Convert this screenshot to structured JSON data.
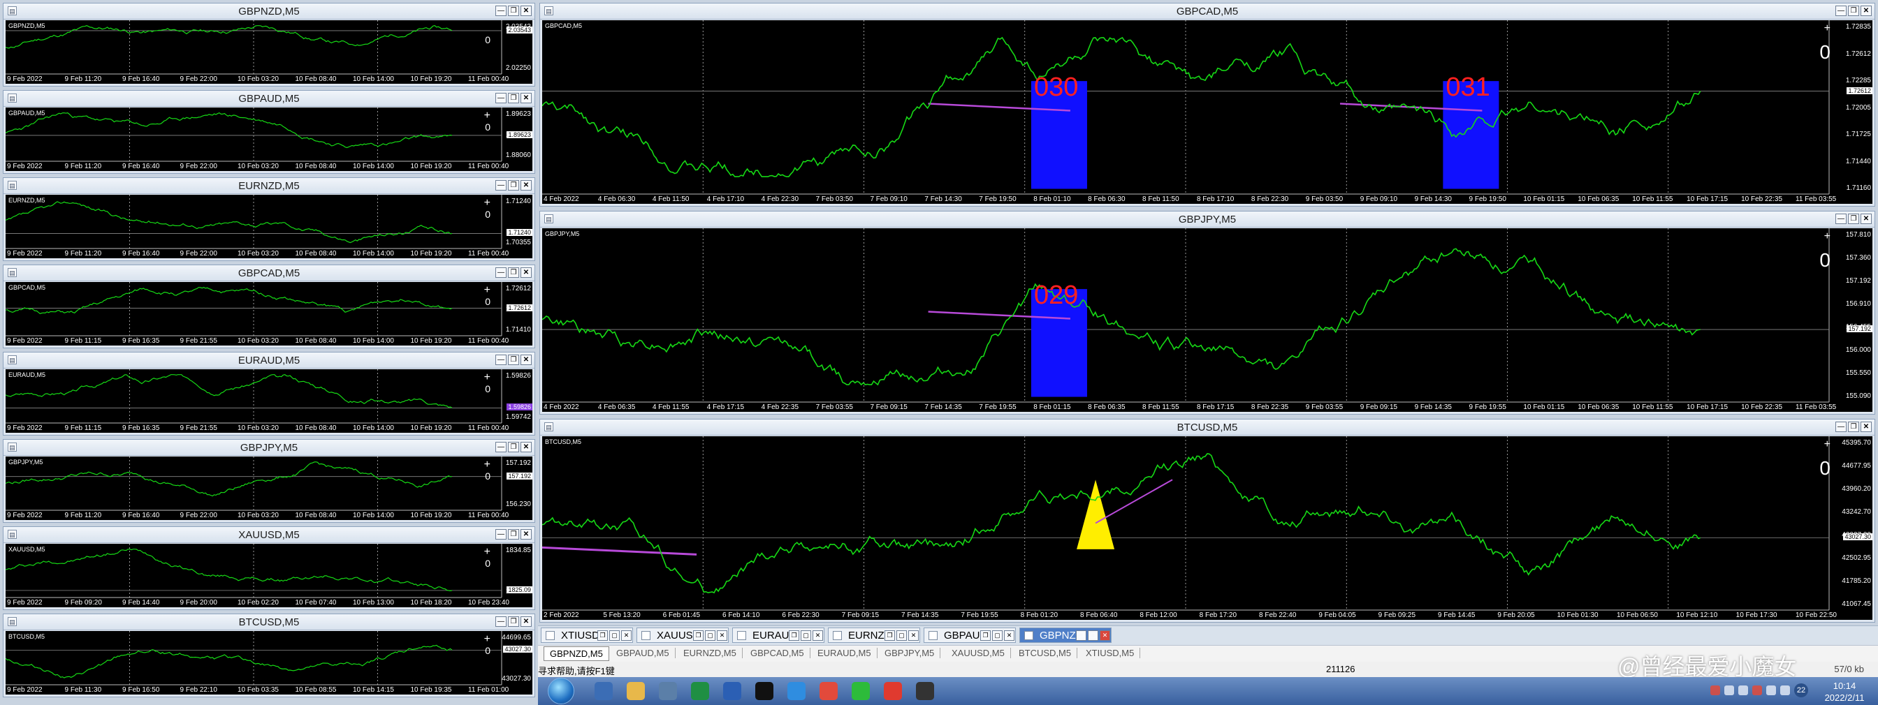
{
  "colors": {
    "line": "#16d915",
    "signal_box": "#1010ff",
    "signal_text": "#ff2020",
    "triangle": "#ffee00",
    "trend": "#b84ad9",
    "chart_bg": "#000000"
  },
  "small_windows": [
    {
      "title": "GBPNZD,M5",
      "symbol": "GBPNZD,M5",
      "seed": 11,
      "x_labels": [
        "9 Feb 2022",
        "9 Feb 11:20",
        "9 Feb 16:40",
        "9 Feb 22:00",
        "10 Feb 03:20",
        "10 Feb 08:40",
        "10 Feb 14:00",
        "10 Feb 19:20",
        "11 Feb 00:40"
      ],
      "price_labels": [
        "2.03543",
        "2.02250"
      ],
      "current_price": "2.03543",
      "plus": "",
      "zero": "0"
    },
    {
      "title": "GBPAUD,M5",
      "symbol": "GBPAUD,M5",
      "seed": 23,
      "x_labels": [
        "9 Feb 2022",
        "9 Feb 11:20",
        "9 Feb 16:40",
        "9 Feb 22:00",
        "10 Feb 03:20",
        "10 Feb 08:40",
        "10 Feb 14:00",
        "10 Feb 19:20",
        "11 Feb 00:40"
      ],
      "price_labels": [
        "1.89623",
        "1.89170",
        "1.88060"
      ],
      "current_price": "1.89623",
      "plus": "+",
      "zero": "0"
    },
    {
      "title": "EURNZD,M5",
      "symbol": "EURNZD,M5",
      "seed": 37,
      "x_labels": [
        "9 Feb 2022",
        "9 Feb 11:20",
        "9 Feb 16:40",
        "9 Feb 22:00",
        "10 Feb 03:20",
        "10 Feb 08:40",
        "10 Feb 14:00",
        "10 Feb 19:20",
        "11 Feb 00:40"
      ],
      "price_labels": [
        "1.71240",
        "1.70355"
      ],
      "current_price": "1.71240",
      "plus": "+",
      "zero": "0"
    },
    {
      "title": "GBPCAD,M5",
      "symbol": "GBPCAD,M5",
      "seed": 51,
      "x_labels": [
        "9 Feb 2022",
        "9 Feb 11:15",
        "9 Feb 16:35",
        "9 Feb 21:55",
        "10 Feb 03:20",
        "10 Feb 08:40",
        "10 Feb 14:00",
        "10 Feb 19:20",
        "11 Feb 00:40"
      ],
      "price_labels": [
        "1.72612",
        "1.72210",
        "1.71410"
      ],
      "current_price": "1.72612",
      "plus": "+",
      "zero": "0"
    },
    {
      "title": "EURAUD,M5",
      "symbol": "EURAUD,M5",
      "seed": 67,
      "x_labels": [
        "9 Feb 2022",
        "9 Feb 11:15",
        "9 Feb 16:35",
        "9 Feb 21:55",
        "10 Feb 03:20",
        "10 Feb 08:40",
        "10 Feb 14:00",
        "10 Feb 19:20",
        "11 Feb 00:40"
      ],
      "price_labels": [
        "1.59826",
        "1.59742"
      ],
      "current_price": "1.59826",
      "plus": "+",
      "zero": "0"
    },
    {
      "title": "GBPJPY,M5",
      "symbol": "GBPJPY,M5",
      "seed": 79,
      "x_labels": [
        "9 Feb 2022",
        "9 Feb 11:20",
        "9 Feb 16:40",
        "9 Feb 22:00",
        "10 Feb 03:20",
        "10 Feb 08:40",
        "10 Feb 14:00",
        "10 Feb 19:20",
        "11 Feb 00:40"
      ],
      "price_labels": [
        "157.192",
        "156.230"
      ],
      "current_price": "157.192",
      "plus": "+",
      "zero": "0"
    },
    {
      "title": "XAUUSD,M5",
      "symbol": "XAUUSD,M5",
      "seed": 97,
      "x_labels": [
        "9 Feb 2022",
        "9 Feb 09:20",
        "9 Feb 14:40",
        "9 Feb 20:00",
        "10 Feb 02:20",
        "10 Feb 07:40",
        "10 Feb 13:00",
        "10 Feb 18:20",
        "10 Feb 23:40"
      ],
      "price_labels": [
        "1834.85",
        "1825.09"
      ],
      "current_price": "1825.09",
      "plus": "+",
      "zero": "0"
    },
    {
      "title": "BTCUSD,M5",
      "symbol": "BTCUSD,M5",
      "seed": 113,
      "x_labels": [
        "9 Feb 2022",
        "9 Feb 11:30",
        "9 Feb 16:50",
        "9 Feb 22:10",
        "10 Feb 03:35",
        "10 Feb 08:55",
        "10 Feb 14:15",
        "10 Feb 19:35",
        "11 Feb 01:00"
      ],
      "price_labels": [
        "44699.65",
        "43027.30"
      ],
      "current_price": "43027.30",
      "plus": "+",
      "zero": "0"
    }
  ],
  "large_windows": [
    {
      "title": "GBPCAD,M5",
      "symbol": "GBPCAD,M5",
      "seed": 131,
      "x_labels": [
        "4 Feb 2022",
        "4 Feb 06:30",
        "4 Feb 11:50",
        "4 Feb 17:10",
        "4 Feb 22:30",
        "7 Feb 03:50",
        "7 Feb 09:10",
        "7 Feb 14:30",
        "7 Feb 19:50",
        "8 Feb 01:10",
        "8 Feb 06:30",
        "8 Feb 11:50",
        "8 Feb 17:10",
        "8 Feb 22:30",
        "9 Feb 03:50",
        "9 Feb 09:10",
        "9 Feb 14:30",
        "9 Feb 19:50",
        "10 Feb 01:15",
        "10 Feb 06:35",
        "10 Feb 11:55",
        "10 Feb 17:15",
        "10 Feb 22:35",
        "11 Feb 03:55"
      ],
      "price_labels": [
        "1.72835",
        "1.72612",
        "1.72285",
        "1.72005",
        "1.71725",
        "1.71440",
        "1.71160"
      ],
      "current_price": "1.72612",
      "plus": "+",
      "zero": "0",
      "signals": [
        "030",
        "031"
      ]
    },
    {
      "title": "GBPJPY,M5",
      "symbol": "GBPJPY,M5",
      "seed": 149,
      "x_labels": [
        "4 Feb 2022",
        "4 Feb 06:35",
        "4 Feb 11:55",
        "4 Feb 17:15",
        "4 Feb 22:35",
        "7 Feb 03:55",
        "7 Feb 09:15",
        "7 Feb 14:35",
        "7 Feb 19:55",
        "8 Feb 01:15",
        "8 Feb 06:35",
        "8 Feb 11:55",
        "8 Feb 17:15",
        "8 Feb 22:35",
        "9 Feb 03:55",
        "9 Feb 09:15",
        "9 Feb 14:35",
        "9 Feb 19:55",
        "10 Feb 01:15",
        "10 Feb 06:35",
        "10 Feb 11:55",
        "10 Feb 17:15",
        "10 Feb 22:35",
        "11 Feb 03:55"
      ],
      "price_labels": [
        "157.810",
        "157.360",
        "157.192",
        "156.910",
        "156.455",
        "156.000",
        "155.550",
        "155.090"
      ],
      "current_price": "157.192",
      "plus": "+",
      "zero": "0",
      "signals": [
        "029"
      ]
    },
    {
      "title": "BTCUSD,M5",
      "symbol": "BTCUSD,M5",
      "seed": 167,
      "x_labels": [
        "2 Feb 2022",
        "5 Feb 13:20",
        "6 Feb 01:45",
        "6 Feb 14:10",
        "6 Feb 22:30",
        "7 Feb 09:15",
        "7 Feb 14:35",
        "7 Feb 19:55",
        "8 Feb 01:20",
        "8 Feb 06:40",
        "8 Feb 12:00",
        "8 Feb 17:20",
        "8 Feb 22:40",
        "9 Feb 04:05",
        "9 Feb 09:25",
        "9 Feb 14:45",
        "9 Feb 20:05",
        "10 Feb 01:30",
        "10 Feb 06:50",
        "10 Feb 12:10",
        "10 Feb 17:30",
        "10 Feb 22:50"
      ],
      "price_labels": [
        "45395.70",
        "44677.95",
        "43960.20",
        "43242.70",
        "43027.30",
        "42502.95",
        "41785.20",
        "41067.45"
      ],
      "current_price": "43027.30",
      "plus": "+",
      "zero": "0",
      "signals": []
    }
  ],
  "window_tabs": [
    {
      "label": "XTIUSD...",
      "active": false
    },
    {
      "label": "XAUUS...",
      "active": false
    },
    {
      "label": "EURAU...",
      "active": false
    },
    {
      "label": "EURNZ...",
      "active": false
    },
    {
      "label": "GBPAU...",
      "active": false
    },
    {
      "label": "GBPNZ...",
      "active": true
    }
  ],
  "symbol_tabs": [
    "GBPNZD,M5",
    "GBPAUD,M5",
    "EURNZD,M5",
    "GBPCAD,M5",
    "EURAUD,M5",
    "GBPJPY,M5",
    "XAUUSD,M5",
    "BTCUSD,M5",
    "XTIUSD,M5"
  ],
  "status": {
    "hint": "寻求帮助,请按F1键",
    "value": "211126",
    "kb": "57/0 kb"
  },
  "watermark": "@曾经最爱小魔女",
  "taskbar": {
    "time": "10:14",
    "date": "2022/2/11",
    "badge": "22",
    "apps": [
      "explorer-app",
      "folder-app",
      "media-app",
      "excel-app",
      "word-app",
      "qq-app",
      "browser-app",
      "chrome-app",
      "wechat-app",
      "wps-app",
      "trading-app"
    ]
  }
}
